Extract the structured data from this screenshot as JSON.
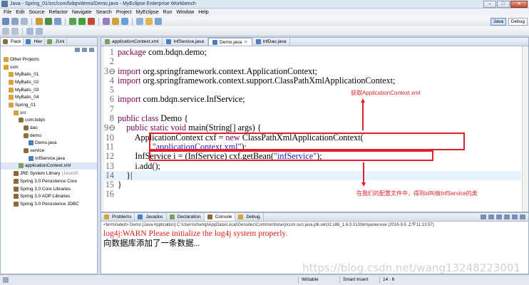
{
  "window": {
    "title": "Java - Spring_01/src/com/bdqn/demo/Demo.java - MyEclipse Enterprise Workbench",
    "buttons": [
      "–",
      "□",
      "✕"
    ]
  },
  "menu": [
    "File",
    "Edit",
    "Source",
    "Refactor",
    "Navigate",
    "Search",
    "Project",
    "MyEclipse",
    "Run",
    "Window",
    "Help"
  ],
  "perspectives": [
    "Java",
    "Debug"
  ],
  "left_panel": {
    "tabs": [
      "Pack",
      "Hier",
      "JUni"
    ],
    "tree": [
      {
        "label": "Other Projects",
        "indent": 0,
        "icon": "project-icon"
      },
      {
        "label": "ssm",
        "indent": 0,
        "icon": "project-icon"
      },
      {
        "label": "MyBatis_01",
        "indent": 1,
        "icon": "project-icon"
      },
      {
        "label": "MyBatis_02",
        "indent": 1,
        "icon": "project-icon"
      },
      {
        "label": "MyBatis_03",
        "indent": 1,
        "icon": "project-icon"
      },
      {
        "label": "MyBatis_04",
        "indent": 1,
        "icon": "project-icon"
      },
      {
        "label": "Spring_01",
        "indent": 1,
        "icon": "project-icon"
      },
      {
        "label": "src",
        "indent": 2,
        "icon": "source-folder-icon"
      },
      {
        "label": "com.bdqn",
        "indent": 3,
        "icon": "package-icon"
      },
      {
        "label": "dao",
        "indent": 4,
        "icon": "package-icon"
      },
      {
        "label": "demo",
        "indent": 4,
        "icon": "package-icon"
      },
      {
        "label": "Demo.java",
        "indent": 5,
        "icon": "java-file-icon"
      },
      {
        "label": "service",
        "indent": 4,
        "icon": "package-icon"
      },
      {
        "label": "InfService.java",
        "indent": 5,
        "icon": "java-file-icon"
      },
      {
        "label": "applicationContext.xml",
        "indent": 3,
        "icon": "xml-file-icon"
      },
      {
        "label": "JRE System Library",
        "suffix": "[JavaSE",
        "indent": 2,
        "icon": "library-icon"
      },
      {
        "label": "Spring 3.0 Persistence Core",
        "indent": 2,
        "icon": "library-icon"
      },
      {
        "label": "Spring 3.0 Core Libraries",
        "indent": 2,
        "icon": "library-icon"
      },
      {
        "label": "Spring 3.0 AOP Libraries",
        "indent": 2,
        "icon": "library-icon"
      },
      {
        "label": "Spring 3.0 Persistence JDBC",
        "indent": 2,
        "icon": "library-icon"
      }
    ]
  },
  "editor": {
    "tabs": [
      {
        "label": "applicationContext.xml",
        "active": false,
        "icon": "xml-file-icon"
      },
      {
        "label": "InfService.java",
        "active": false,
        "icon": "java-file-icon"
      },
      {
        "label": "Demo.java",
        "active": true,
        "icon": "java-file-icon"
      },
      {
        "label": "InfDao.java",
        "active": false,
        "icon": "java-file-icon"
      }
    ],
    "lines": [
      {
        "n": "1",
        "segs": [
          [
            "kw",
            "package"
          ],
          [
            "",
            " com.bdqn.demo;"
          ]
        ]
      },
      {
        "n": "2",
        "segs": []
      },
      {
        "n": "3⊖",
        "segs": [
          [
            "kw",
            "import"
          ],
          [
            "",
            " org.springframework.context.ApplicationContext;"
          ]
        ]
      },
      {
        "n": "4",
        "segs": [
          [
            "kw",
            "import"
          ],
          [
            "",
            " org.springframework.context.support.ClassPathXmlApplicationContext;"
          ]
        ]
      },
      {
        "n": "5",
        "segs": []
      },
      {
        "n": "6",
        "segs": [
          [
            "kw",
            "import"
          ],
          [
            "",
            " com.bdqn.service.InfService;"
          ]
        ]
      },
      {
        "n": "7",
        "segs": []
      },
      {
        "n": "8",
        "segs": [
          [
            "kw",
            "public class"
          ],
          [
            "",
            " Demo {"
          ]
        ]
      },
      {
        "n": "9⊖",
        "segs": [
          [
            "",
            "    "
          ],
          [
            "kw",
            "public static void"
          ],
          [
            "",
            " main(String[] args) {"
          ]
        ]
      },
      {
        "n": "10",
        "segs": [
          [
            "",
            "        ApplicationContext cxf = "
          ],
          [
            "kw",
            "new"
          ],
          [
            "",
            " ClassPathXmlApplicationContext("
          ]
        ]
      },
      {
        "n": "11",
        "segs": [
          [
            "",
            "                "
          ],
          [
            "str",
            "\"applicationContext.xml\""
          ],
          [
            "",
            ");"
          ]
        ]
      },
      {
        "n": "12",
        "segs": [
          [
            "",
            "        InfService i = (InfService) cxf.getBean("
          ],
          [
            "str",
            "\"infService\""
          ],
          [
            "",
            ");"
          ]
        ]
      },
      {
        "n": "13",
        "segs": [
          [
            "",
            "        i.add();"
          ]
        ]
      },
      {
        "n": "14",
        "segs": [
          [
            "",
            "    }|"
          ]
        ],
        "highlight": true
      },
      {
        "n": "15",
        "segs": [
          [
            "",
            "}"
          ]
        ]
      },
      {
        "n": "16",
        "segs": []
      }
    ],
    "annotations": {
      "top": "获取ApplicationContext.xml",
      "bottom": "在我们的配置文件中，得到id叫做InfService的类"
    }
  },
  "console": {
    "tabs": [
      "Problems",
      "Javadoc",
      "Declaration",
      "Console",
      "Debug"
    ],
    "terminated": "<terminated> Demo [Java Application] C:\\Users\\chenqi\\AppData\\Local\\Genuitec\\Common\\binary\\com.sun.java.jdk.win32.x86_1.6.0.013\\bin\\javaw.exe (2016-9-5 上午11:13:57)",
    "lines": [
      {
        "text": "log4j:WARN Please initialize the log4j system properly.",
        "error": true
      },
      {
        "text": "向数据库添加了一条数据...",
        "error": false
      }
    ]
  },
  "status": {
    "mode": "Writable",
    "insert": "Smart Insert",
    "position": "14 : 6"
  },
  "watermark": "https://blog.csdn.net/wang13248223001",
  "colors": {
    "keyword": "#7f0055",
    "string": "#1a1ac8",
    "annotation": "#e0202a",
    "console_error": "#e11b1b"
  }
}
